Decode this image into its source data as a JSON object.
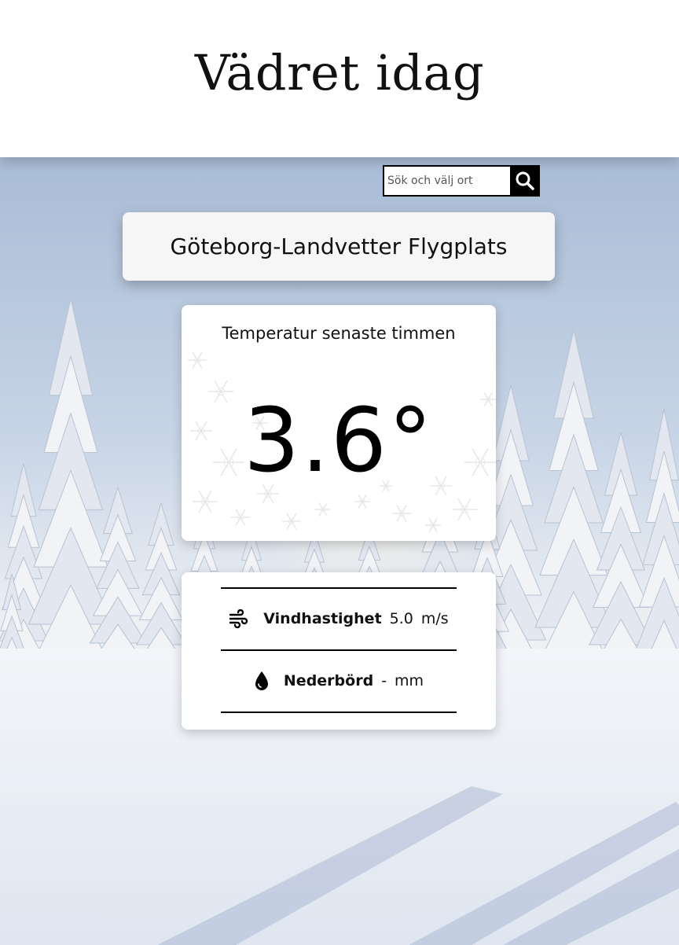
{
  "header": {
    "title": "Vädret idag"
  },
  "search": {
    "placeholder": "Sök och välj ort",
    "button_icon": "search-icon"
  },
  "location": {
    "name": "Göteborg-Landvetter Flygplats"
  },
  "temperature": {
    "label": "Temperatur senaste timmen",
    "value": "3.6°"
  },
  "details": {
    "wind": {
      "icon": "wind-icon",
      "label": "Vindhastighet",
      "value": "5.0",
      "unit": "m/s"
    },
    "precipitation": {
      "icon": "water-drop-icon",
      "label": "Nederbörd",
      "value": "-",
      "unit": "mm"
    }
  },
  "colors": {
    "accent": "#000000",
    "card": "#ffffff",
    "sky_top": "#aebfd8",
    "snow": "#e9eef6"
  }
}
